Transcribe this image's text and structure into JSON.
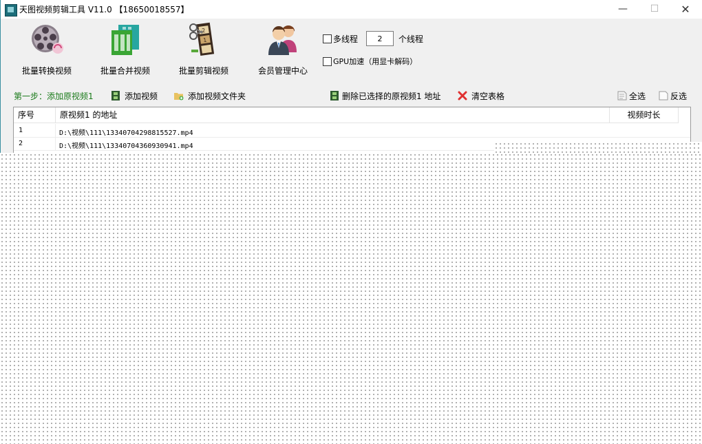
{
  "window": {
    "title": "天图视频剪辑工具 V11.0 【18650018557】",
    "controls": {
      "minimize": "—",
      "maximize": "☐",
      "close": "✕"
    }
  },
  "toolbar": {
    "buttons": [
      {
        "label": "批量转换视频",
        "icon": "film-reel-icon"
      },
      {
        "label": "批量合并视频",
        "icon": "merge-grid-icon"
      },
      {
        "label": "批量剪辑视频",
        "icon": "film-cut-icon"
      },
      {
        "label": "会员管理中心",
        "icon": "members-icon"
      }
    ]
  },
  "options": {
    "multithread_label": "多线程",
    "multithread_checked": false,
    "thread_count": "2",
    "thread_unit": "个线程",
    "gpu_label": "GPU加速（用显卡解码）",
    "gpu_checked": false
  },
  "step": {
    "label": "第一步：添加原视频1",
    "add_video": "添加视频",
    "add_folder": "添加视频文件夹",
    "delete_selected": "删除已选择的原视频1 地址",
    "clear_table": "清空表格",
    "select_all": "全选",
    "invert_select": "反选"
  },
  "table": {
    "headers": [
      "序号",
      "原视频1 的地址",
      "视频时长"
    ],
    "rows": [
      {
        "no": "1",
        "path": "D:\\视频\\111\\13340704298815527.mp4"
      },
      {
        "no": "2",
        "path": "D:\\视频\\111\\13340704360930941.mp4"
      }
    ]
  },
  "colors": {
    "step_text": "#1a7a1a",
    "delete_icon": "#e03030",
    "frame_border": "#3a8fa0"
  }
}
